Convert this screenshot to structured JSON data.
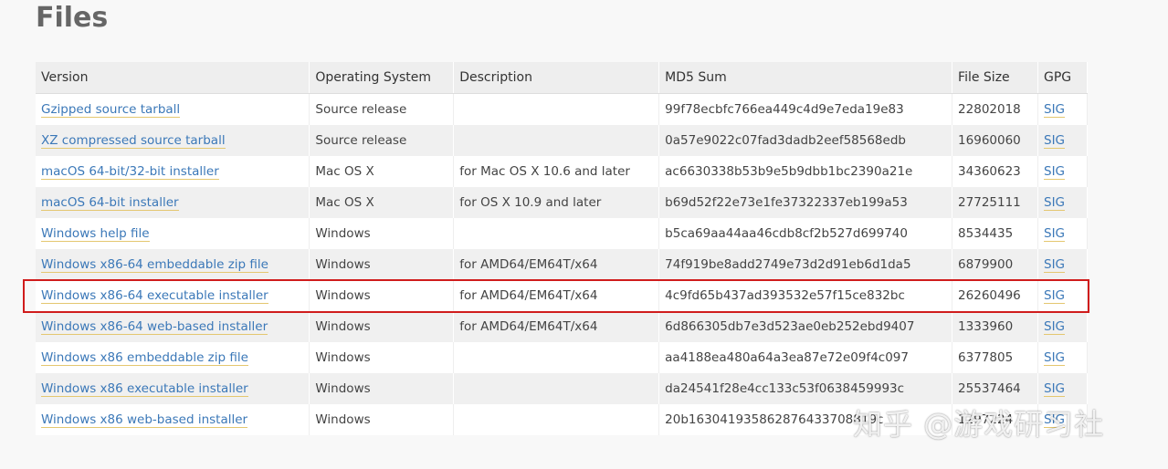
{
  "section": {
    "title": "Files"
  },
  "table": {
    "headers": [
      "Version",
      "Operating System",
      "Description",
      "MD5 Sum",
      "File Size",
      "GPG"
    ],
    "rows": [
      {
        "version": "Gzipped source tarball",
        "os": "Source release",
        "description": "",
        "md5": "99f78ecbfc766ea449c4d9e7eda19e83",
        "size": "22802018",
        "gpg": "SIG"
      },
      {
        "version": "XZ compressed source tarball",
        "os": "Source release",
        "description": "",
        "md5": "0a57e9022c07fad3dadb2eef58568edb",
        "size": "16960060",
        "gpg": "SIG"
      },
      {
        "version": "macOS 64-bit/32-bit installer",
        "os": "Mac OS X",
        "description": "for Mac OS X 10.6 and later",
        "md5": "ac6630338b53b9e5b9dbb1bc2390a21e",
        "size": "34360623",
        "gpg": "SIG"
      },
      {
        "version": "macOS 64-bit installer",
        "os": "Mac OS X",
        "description": "for OS X 10.9 and later",
        "md5": "b69d52f22e73e1fe37322337eb199a53",
        "size": "27725111",
        "gpg": "SIG"
      },
      {
        "version": "Windows help file",
        "os": "Windows",
        "description": "",
        "md5": "b5ca69aa44aa46cdb8cf2b527d699740",
        "size": "8534435",
        "gpg": "SIG"
      },
      {
        "version": "Windows x86-64 embeddable zip file",
        "os": "Windows",
        "description": "for AMD64/EM64T/x64",
        "md5": "74f919be8add2749e73d2d91eb6d1da5",
        "size": "6879900",
        "gpg": "SIG"
      },
      {
        "version": "Windows x86-64 executable installer",
        "os": "Windows",
        "description": "for AMD64/EM64T/x64",
        "md5": "4c9fd65b437ad393532e57f15ce832bc",
        "size": "26260496",
        "gpg": "SIG"
      },
      {
        "version": "Windows x86-64 web-based installer",
        "os": "Windows",
        "description": "for AMD64/EM64T/x64",
        "md5": "6d866305db7e3d523ae0eb252ebd9407",
        "size": "1333960",
        "gpg": "SIG"
      },
      {
        "version": "Windows x86 embeddable zip file",
        "os": "Windows",
        "description": "",
        "md5": "aa4188ea480a64a3ea87e72e09f4c097",
        "size": "6377805",
        "gpg": "SIG"
      },
      {
        "version": "Windows x86 executable installer",
        "os": "Windows",
        "description": "",
        "md5": "da24541f28e4cc133c53f0638459993c",
        "size": "25537464",
        "gpg": "SIG"
      },
      {
        "version": "Windows x86 web-based installer",
        "os": "Windows",
        "description": "",
        "md5": "20b163041935862876433708819c",
        "size": "1297224",
        "gpg": "SIG"
      }
    ],
    "highlighted_row_index": 6
  },
  "watermark": {
    "text": "知乎 @游戏研习社"
  },
  "colors": {
    "link": "#3b78b8",
    "link_underline": "#e4c770",
    "highlight_border": "#d01c1c",
    "title": "#666666"
  }
}
